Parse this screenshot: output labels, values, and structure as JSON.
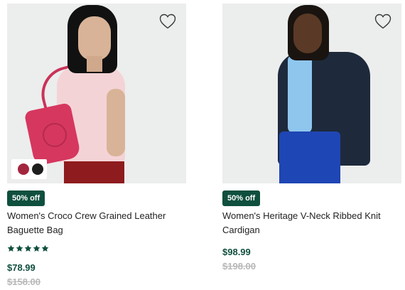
{
  "products": [
    {
      "badge": "50% off",
      "title_line1": "Women's Croco Crew Grained Leather",
      "title_line2": "Baguette Bag",
      "rating": 5,
      "price": "$78.99",
      "original_price": "$158.00",
      "swatches": [
        "#a3263f",
        "#1e1e1e"
      ],
      "wishlist_icon": "heart-outline-icon"
    },
    {
      "badge": "50% off",
      "title_line1": "Women's Heritage V-Neck Ribbed Knit",
      "title_line2": "Cardigan",
      "price": "$98.99",
      "original_price": "$198.00",
      "wishlist_icon": "heart-outline-icon"
    }
  ],
  "colors": {
    "accent": "#0f4f3e",
    "strikethrough": "#b8b8b8"
  }
}
